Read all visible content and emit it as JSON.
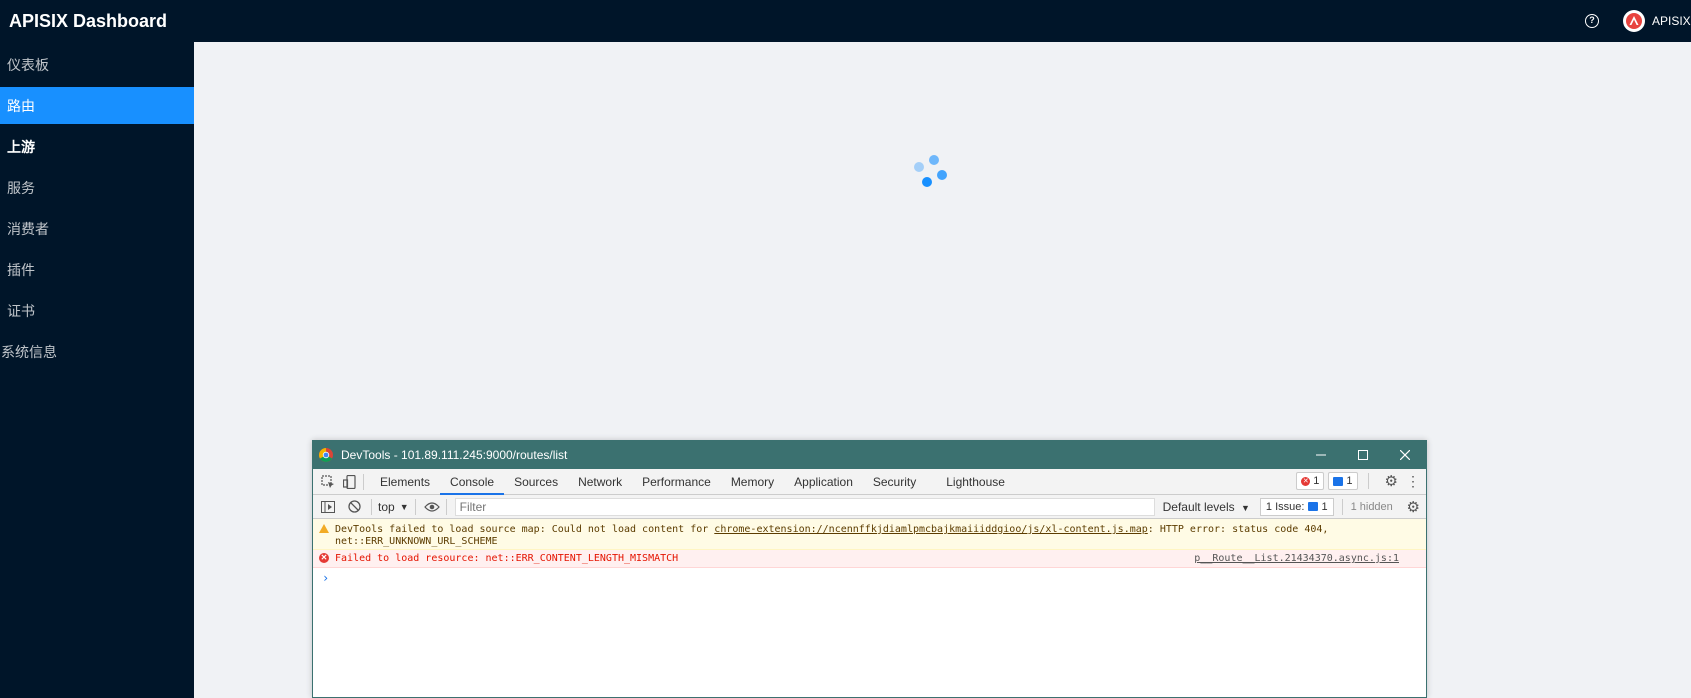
{
  "header": {
    "title": "APISIX Dashboard",
    "help_icon": "question-circle-icon",
    "help_glyph": "?",
    "user_name": "APISIX"
  },
  "sidebar": {
    "items": [
      {
        "label": "仪表板"
      },
      {
        "label": "路由"
      },
      {
        "label": "上游"
      },
      {
        "label": "服务"
      },
      {
        "label": "消费者"
      },
      {
        "label": "插件"
      },
      {
        "label": "证书"
      },
      {
        "label": "系统信息"
      }
    ],
    "active_index": 1
  },
  "colors": {
    "nav_bg": "#001529",
    "active": "#1890ff",
    "content_bg": "#f0f2f5",
    "devtools_title": "#3b7170"
  },
  "devtools": {
    "title": "DevTools - 101.89.111.245:9000/routes/list",
    "tabs": [
      "Elements",
      "Console",
      "Sources",
      "Network",
      "Performance",
      "Memory",
      "Application",
      "Security",
      "Lighthouse"
    ],
    "active_tab": "Console",
    "error_count": "1",
    "message_count": "1",
    "toolbar": {
      "context": "top",
      "filter_placeholder": "Filter",
      "levels": "Default levels",
      "issues_label": "1 Issue:",
      "issues_count": "1",
      "hidden": "1 hidden"
    },
    "messages": {
      "warning_prefix": "DevTools failed to load source map: Could not load content for ",
      "warning_link": "chrome-extension://ncennffkjdiamlpmcbajkmaiiiddgioo/js/xl-content.js.map",
      "warning_suffix": ": HTTP error: status code 404,",
      "warning_line2": "net::ERR_UNKNOWN_URL_SCHEME",
      "error_text": "Failed to load resource: net::ERR_CONTENT_LENGTH_MISMATCH",
      "error_source": "p__Route__List.21434370.async.js:1"
    },
    "prompt": "›"
  }
}
